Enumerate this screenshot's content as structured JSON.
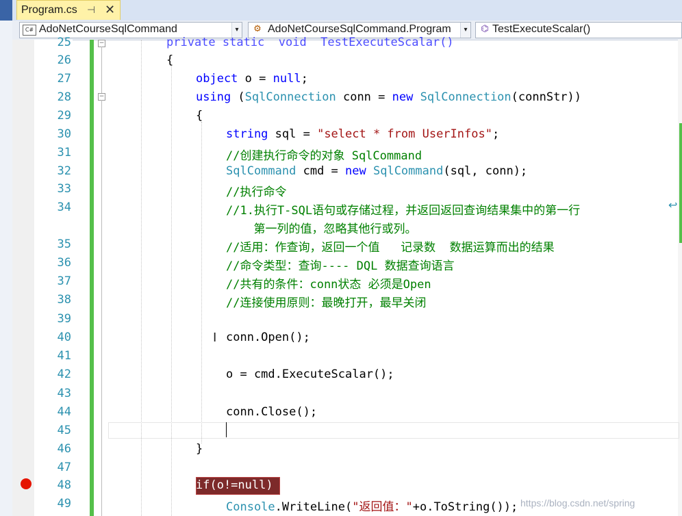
{
  "tab": {
    "title": "Program.cs",
    "pin_glyph": "⊣",
    "close_glyph": "✕"
  },
  "navbar": {
    "project": "AdoNetCourseSqlCommand",
    "class": "AdoNetCourseSqlCommand.Program",
    "member": "TestExecuteScalar()"
  },
  "lines": [
    {
      "n": "25",
      "tokens": [
        {
          "t": "private static  void  TestExecuteScalar()",
          "c": "kwpart"
        }
      ]
    },
    {
      "n": "26",
      "tokens": [
        {
          "t": "{",
          "c": ""
        }
      ]
    },
    {
      "n": "27",
      "tokens": [
        {
          "t": "object",
          "c": "kw"
        },
        {
          "t": " o = ",
          "c": ""
        },
        {
          "t": "null",
          "c": "kw"
        },
        {
          "t": ";",
          "c": ""
        }
      ]
    },
    {
      "n": "28",
      "tokens": [
        {
          "t": "using",
          "c": "kw"
        },
        {
          "t": " (",
          "c": ""
        },
        {
          "t": "SqlConnection",
          "c": "ty"
        },
        {
          "t": " conn = ",
          "c": ""
        },
        {
          "t": "new",
          "c": "kw"
        },
        {
          "t": " ",
          "c": ""
        },
        {
          "t": "SqlConnection",
          "c": "ty"
        },
        {
          "t": "(connStr))",
          "c": ""
        }
      ]
    },
    {
      "n": "29",
      "tokens": [
        {
          "t": "{",
          "c": ""
        }
      ]
    },
    {
      "n": "30",
      "tokens": [
        {
          "t": "string",
          "c": "kw"
        },
        {
          "t": " sql = ",
          "c": ""
        },
        {
          "t": "\"select * from UserInfos\"",
          "c": "str"
        },
        {
          "t": ";",
          "c": ""
        }
      ]
    },
    {
      "n": "31",
      "tokens": [
        {
          "t": "//创建执行命令的对象 SqlCommand",
          "c": "cm"
        }
      ]
    },
    {
      "n": "32",
      "tokens": [
        {
          "t": "SqlCommand",
          "c": "ty"
        },
        {
          "t": " cmd = ",
          "c": ""
        },
        {
          "t": "new",
          "c": "kw"
        },
        {
          "t": " ",
          "c": ""
        },
        {
          "t": "SqlCommand",
          "c": "ty"
        },
        {
          "t": "(sql, conn);",
          "c": ""
        }
      ]
    },
    {
      "n": "33",
      "tokens": [
        {
          "t": "//执行命令",
          "c": "cm"
        }
      ]
    },
    {
      "n": "34",
      "tokens": [
        {
          "t": "//1.执行T-SQL语句或存储过程，并返回返回查询结果集中的第一行",
          "c": "cm"
        }
      ]
    },
    {
      "n": "",
      "tokens": [
        {
          "t": "  第一列的值，忽略其他行或列。",
          "c": "cm"
        }
      ]
    },
    {
      "n": "35",
      "tokens": [
        {
          "t": "//适用：作查询，返回一个值   记录数  数据运算而出的结果",
          "c": "cm"
        }
      ]
    },
    {
      "n": "36",
      "tokens": [
        {
          "t": "//命令类型：查询---- DQL 数据查询语言",
          "c": "cm"
        }
      ]
    },
    {
      "n": "37",
      "tokens": [
        {
          "t": "//共有的条件：conn状态 必须是Open",
          "c": "cm"
        }
      ]
    },
    {
      "n": "38",
      "tokens": [
        {
          "t": "//连接使用原则：最晚打开，最早关闭",
          "c": "cm"
        }
      ]
    },
    {
      "n": "39",
      "tokens": []
    },
    {
      "n": "40",
      "tokens": [
        {
          "t": "conn.Open();",
          "c": ""
        }
      ]
    },
    {
      "n": "41",
      "tokens": []
    },
    {
      "n": "42",
      "tokens": [
        {
          "t": "o = cmd.ExecuteScalar();",
          "c": ""
        }
      ]
    },
    {
      "n": "43",
      "tokens": []
    },
    {
      "n": "44",
      "tokens": [
        {
          "t": "conn.Close();",
          "c": ""
        }
      ]
    },
    {
      "n": "45",
      "tokens": []
    },
    {
      "n": "46",
      "tokens": [
        {
          "t": "}",
          "c": ""
        }
      ]
    },
    {
      "n": "47",
      "tokens": []
    },
    {
      "n": "48",
      "tokens": [
        {
          "t": "if(o!=null)",
          "c": "bp"
        }
      ]
    },
    {
      "n": "49",
      "tokens": [
        {
          "t": "Console",
          "c": "ty"
        },
        {
          "t": ".WriteLine(",
          "c": ""
        },
        {
          "t": "\"返回值：\"",
          "c": "str"
        },
        {
          "t": "+o.ToString());",
          "c": ""
        }
      ]
    }
  ],
  "wrap_glyph": "↩",
  "watermark": "https://blog.csdn.net/spring",
  "colors": {
    "keyword": "#0000ff",
    "type": "#2b91af",
    "string": "#a31515",
    "comment": "#008000",
    "breakpoint": "#e51400"
  }
}
